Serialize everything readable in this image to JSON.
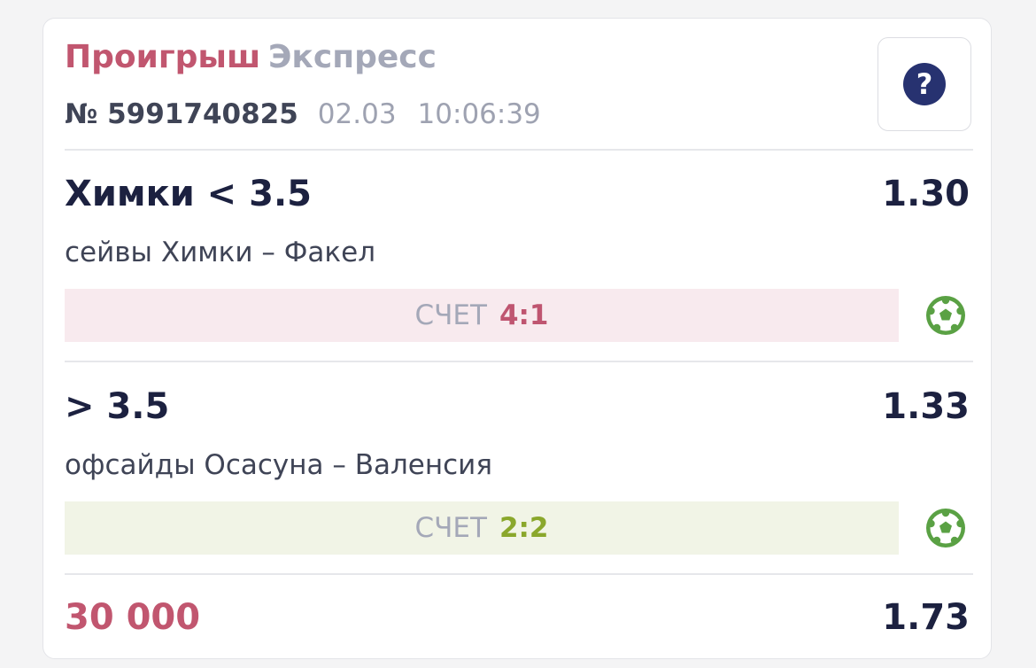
{
  "bet": {
    "status": "Проигрыш",
    "type": "Экспресс",
    "number": "№ 5991740825",
    "date": "02.03",
    "time": "10:06:39",
    "help_label": "?"
  },
  "selections": [
    {
      "title": "Химки < 3.5",
      "odds": "1.30",
      "subtitle": "сейвы Химки – Факел",
      "score_label": "СЧЕТ",
      "score": "4:1",
      "result": "loss",
      "sport_icon": "soccer-ball-icon"
    },
    {
      "title": "> 3.5",
      "odds": "1.33",
      "subtitle": "офсайды Осасуна – Валенсия",
      "score_label": "СЧЕТ",
      "score": "2:2",
      "result": "win",
      "sport_icon": "soccer-ball-icon"
    }
  ],
  "footer": {
    "stake": "30 000",
    "total_odds": "1.73"
  },
  "colors": {
    "loss_accent": "#c1566f",
    "win_accent": "#8aa72c",
    "ball_green": "#5aa144",
    "help_navy": "#273270"
  }
}
